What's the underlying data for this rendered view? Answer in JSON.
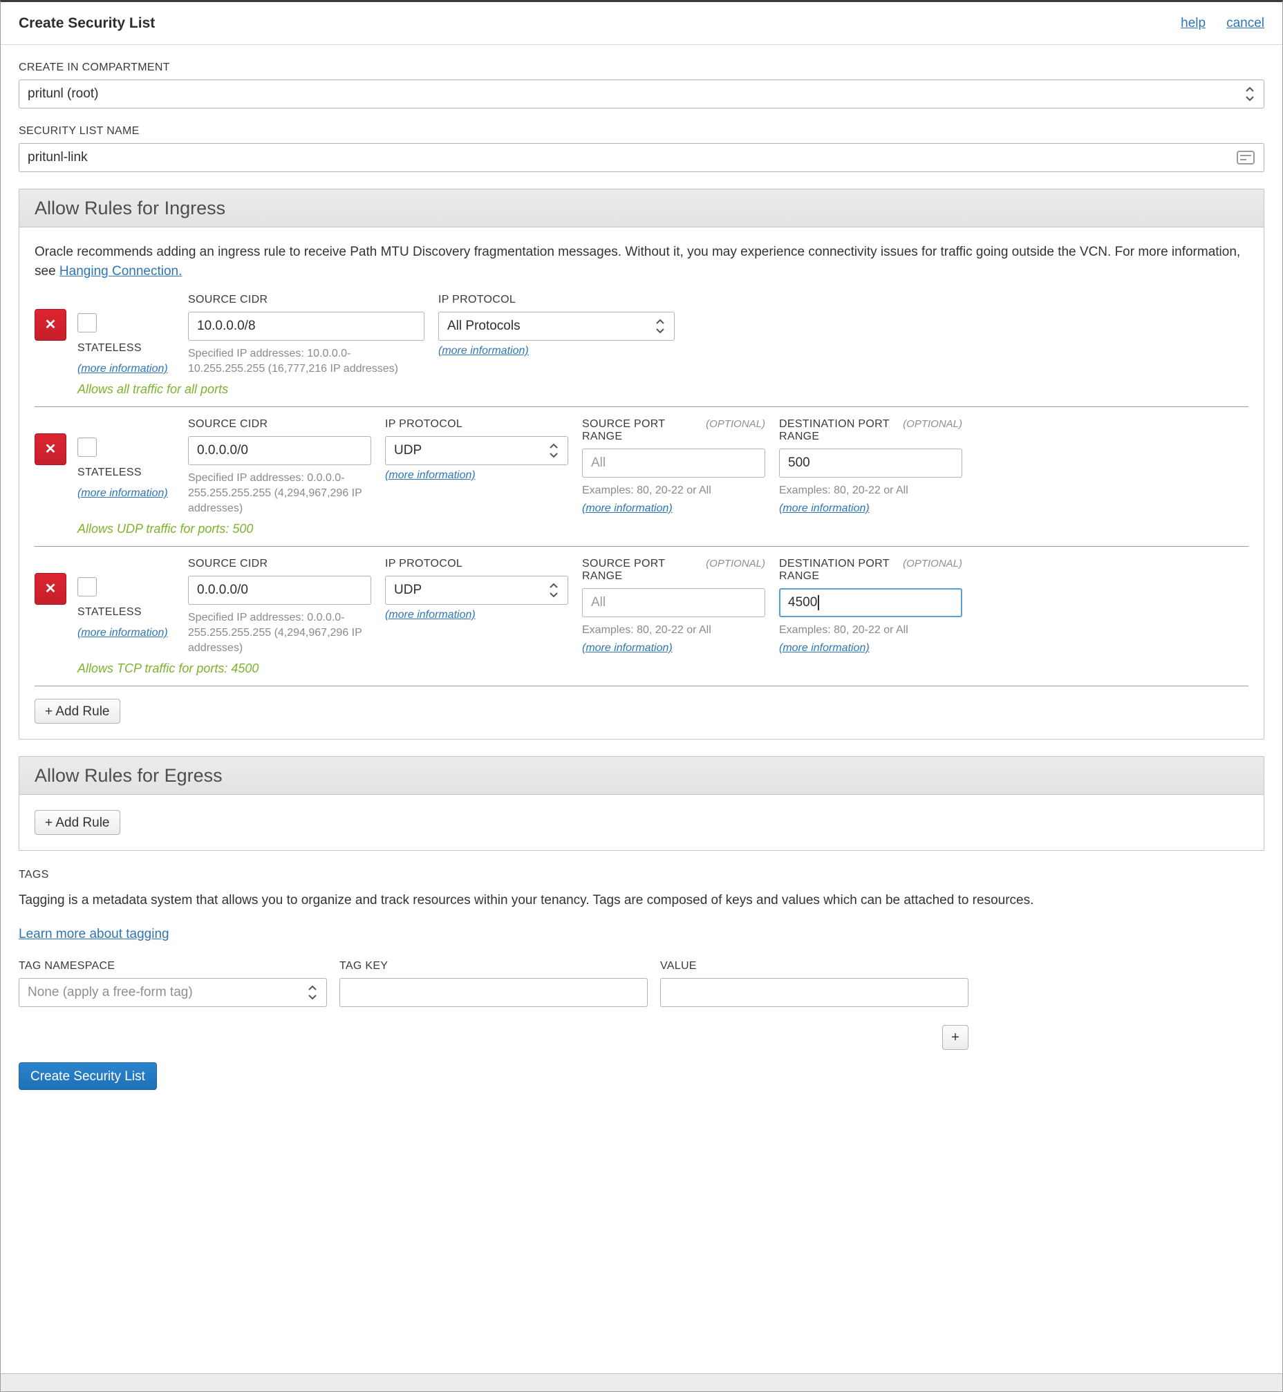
{
  "colors": {
    "accent_link": "#2e75b5",
    "danger_delete": "#d5202c",
    "success_summary": "#7db32b",
    "primary_button": "#1f78c1"
  },
  "header": {
    "title": "Create Security List",
    "help_link": "help",
    "cancel_link": "cancel"
  },
  "form": {
    "compartment": {
      "label": "CREATE IN COMPARTMENT",
      "value": "pritunl (root)"
    },
    "security_list_name": {
      "label": "SECURITY LIST NAME",
      "value": "pritunl-link"
    }
  },
  "ingress": {
    "title": "Allow Rules for Ingress",
    "notice_text": "Oracle recommends adding an ingress rule to receive Path MTU Discovery fragmentation messages. Without it, you may experience connectivity issues for traffic going outside the VCN. For more information, see ",
    "notice_link": "Hanging Connection.",
    "stateless_label": "STATELESS",
    "more_information": "(more information)",
    "optional_label": "(OPTIONAL)",
    "labels": {
      "source_cidr": "SOURCE CIDR",
      "ip_protocol": "IP PROTOCOL",
      "source_port": "SOURCE PORT RANGE",
      "destination_port": "DESTINATION PORT RANGE"
    },
    "port_examples": "Examples: 80, 20-22 or All",
    "add_rule_label": "+ Add Rule",
    "rules": [
      {
        "source_cidr": "10.0.0.0/8",
        "cidr_helper": "Specified IP addresses: 10.0.0.0-10.255.255.255 (16,777,216 IP addresses)",
        "ip_protocol": "All Protocols",
        "summary": "Allows all traffic for all ports"
      },
      {
        "source_cidr": "0.0.0.0/0",
        "cidr_helper": "Specified IP addresses: 0.0.0.0-255.255.255.255 (4,294,967,296 IP addresses)",
        "ip_protocol": "UDP",
        "source_port_placeholder": "All",
        "destination_port": "500",
        "summary": "Allows UDP traffic for ports: 500"
      },
      {
        "source_cidr": "0.0.0.0/0",
        "cidr_helper": "Specified IP addresses: 0.0.0.0-255.255.255.255 (4,294,967,296 IP addresses)",
        "ip_protocol": "UDP",
        "source_port_placeholder": "All",
        "destination_port": "4500",
        "summary": "Allows TCP traffic for ports: 4500"
      }
    ]
  },
  "egress": {
    "title": "Allow Rules for Egress",
    "add_rule_label": "+ Add Rule"
  },
  "tags": {
    "label": "TAGS",
    "description": "Tagging is a metadata system that allows you to organize and track resources within your tenancy. Tags are composed of keys and values which can be attached to resources.",
    "learn_more_link": "Learn more about tagging",
    "namespace": {
      "label": "TAG NAMESPACE",
      "value": "None (apply a free-form tag)"
    },
    "key": {
      "label": "TAG KEY"
    },
    "value": {
      "label": "VALUE"
    },
    "add_tag_label": "+"
  },
  "footer": {
    "create_button": "Create Security List"
  }
}
